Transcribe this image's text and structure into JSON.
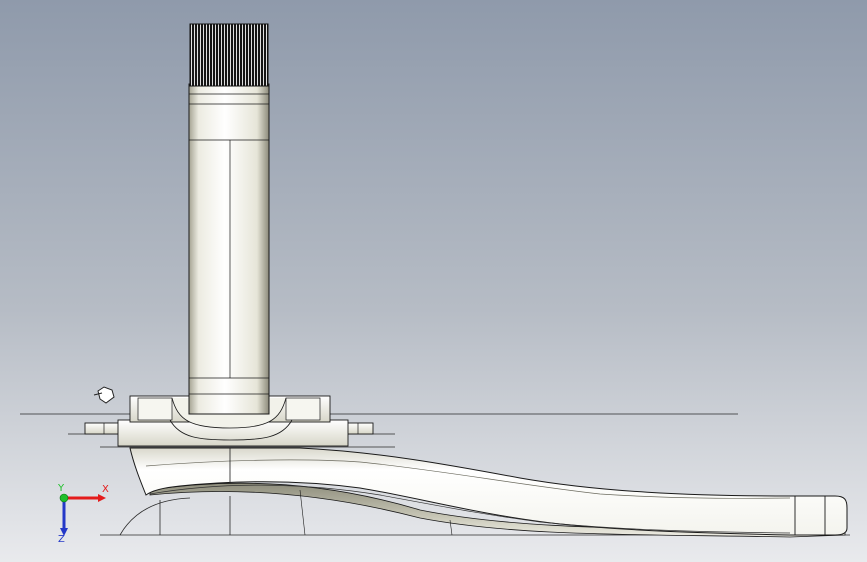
{
  "viewport": {
    "background_top": "#8f9aab",
    "background_bottom": "#e9eaed"
  },
  "model": {
    "body_color": "#f3f3ec",
    "shade_color": "#8d8c7f",
    "edge_color": "#1a1a1a",
    "spline_color": "#111111"
  },
  "triad": {
    "x_label": "X",
    "y_label": "Y",
    "z_label": "Z",
    "x_color": "#e41b1b",
    "y_color": "#1fbf2a",
    "z_color": "#2438c8"
  },
  "cursor": {
    "icon": "rotate-view-cursor-icon"
  }
}
